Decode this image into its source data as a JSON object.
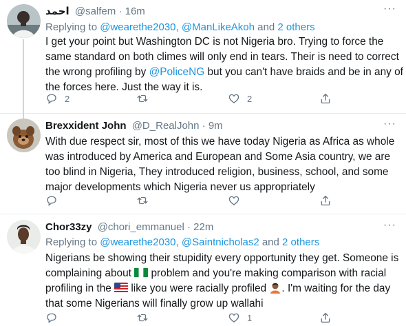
{
  "tweets": [
    {
      "name": "احمد",
      "handle": "@salfem",
      "dot": "·",
      "time": "16m",
      "more": "···",
      "replying_prefix": "Replying to ",
      "replying_to": [
        "@wearethe2030",
        "@ManLikeAkoh"
      ],
      "replying_sep": ", ",
      "replying_and": " and ",
      "replying_others": "2 others",
      "lines": [
        "I get your point but Washington DC is not Nigeria bro. Trying to force the",
        "same standard on both climes will only end in tears.  Their is need to correct"
      ],
      "line3_pre": "the wrong profiling by ",
      "line3_mention": "@PoliceNG",
      "line3_post": " but you can't have braids and be in any of",
      "line4": "the forces here. Just the way it is.",
      "reply_count": "2",
      "retweet_count": "",
      "like_count": "2"
    },
    {
      "name": "Brexxident John",
      "handle": "@D_RealJohn",
      "dot": "·",
      "time": "9m",
      "more": "···",
      "lines": [
        "With due respect sir, most of this we have today Nigeria as Africa as whole",
        "was introduced by America and European and Some Asia country, we are",
        "too blind in Nigeria, They introduced religion, business, school, and some",
        "major developments which Nigeria never us appropriately"
      ],
      "reply_count": "",
      "retweet_count": "",
      "like_count": ""
    },
    {
      "name": "Chor33zy",
      "handle": "@chori_emmanuel",
      "dot": "·",
      "time": "22m",
      "more": "···",
      "replying_prefix": "Replying to ",
      "replying_to": [
        "@wearethe2030",
        "@Saintnicholas2"
      ],
      "replying_sep": ", ",
      "replying_and": " and ",
      "replying_others": "2 others",
      "line1": "Nigerians be showing their stupidity every opportunity they get. Someone is",
      "line2_pre": "complaining about ",
      "line2_post": " problem and you're making comparison with racial",
      "line3_pre": "profiling in the ",
      "line3_mid": " like you were racially profiled ",
      "line3_post": ". I'm waiting for the day",
      "line4": "that some Nigerians will finally grow up wallahi",
      "reply_count": "",
      "retweet_count": "",
      "like_count": "1"
    }
  ],
  "icons": {
    "reply": "reply-icon",
    "retweet": "retweet-icon",
    "like": "heart-icon",
    "share": "share-icon",
    "nigeria_flag": "nigeria-flag-icon",
    "us_flag": "us-flag-icon",
    "person_emoji": "person-emoji-icon"
  },
  "colors": {
    "link": "#1b95e0",
    "muted": "#657786",
    "text": "#14171a",
    "divider": "#e6ecf0",
    "thread_line": "#ccd6dd"
  }
}
